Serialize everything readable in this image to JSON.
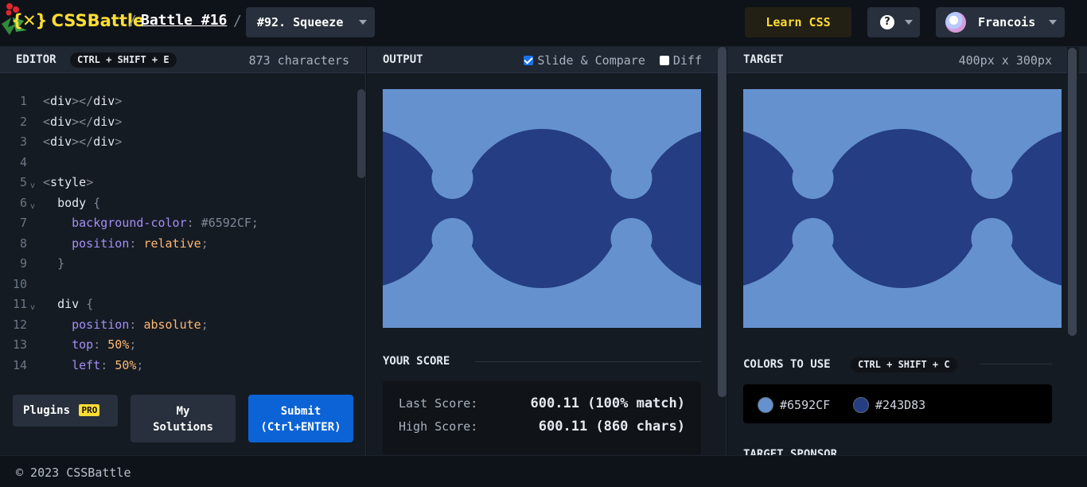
{
  "header": {
    "logo": "CSSBattle",
    "logo_mark": "{✕}",
    "separator": "/",
    "battle": "Battle #16",
    "target_select": "#92. Squeeze",
    "learn": "Learn CSS",
    "help": "?",
    "user": "Francois"
  },
  "editor": {
    "title": "EDITOR",
    "shortcut": "CTRL + SHIFT + E",
    "char_count": "873 characters",
    "lines": [
      {
        "n": "1",
        "fold": false,
        "html": "<span class='t-punc'>&lt;</span><span class='t-tag'>div</span><span class='t-punc'>&gt;&lt;/</span><span class='t-tag'>div</span><span class='t-punc'>&gt;</span>"
      },
      {
        "n": "2",
        "fold": false,
        "html": "<span class='t-punc'>&lt;</span><span class='t-tag'>div</span><span class='t-punc'>&gt;&lt;/</span><span class='t-tag'>div</span><span class='t-punc'>&gt;</span>"
      },
      {
        "n": "3",
        "fold": false,
        "html": "<span class='t-punc'>&lt;</span><span class='t-tag'>div</span><span class='t-punc'>&gt;&lt;/</span><span class='t-tag'>div</span><span class='t-punc'>&gt;</span>"
      },
      {
        "n": "4",
        "fold": false,
        "html": ""
      },
      {
        "n": "5",
        "fold": true,
        "html": "<span class='t-punc'>&lt;</span><span class='t-tag'>style</span><span class='t-punc'>&gt;</span>"
      },
      {
        "n": "6",
        "fold": true,
        "html": "  <span class='t-tag'>body</span> <span class='t-punc'>{</span>"
      },
      {
        "n": "7",
        "fold": false,
        "html": "    <span class='t-prop'>background-color</span><span class='t-punc'>:</span> <span class='t-hex'>#6592CF</span><span class='t-punc'>;</span>"
      },
      {
        "n": "8",
        "fold": false,
        "html": "    <span class='t-prop'>position</span><span class='t-punc'>:</span> <span class='t-val'>relative</span><span class='t-punc'>;</span>"
      },
      {
        "n": "9",
        "fold": false,
        "html": "  <span class='t-punc'>}</span>"
      },
      {
        "n": "10",
        "fold": false,
        "html": ""
      },
      {
        "n": "11",
        "fold": true,
        "html": "  <span class='t-tag'>div</span> <span class='t-punc'>{</span>"
      },
      {
        "n": "12",
        "fold": false,
        "html": "    <span class='t-prop'>position</span><span class='t-punc'>:</span> <span class='t-val'>absolute</span><span class='t-punc'>;</span>"
      },
      {
        "n": "13",
        "fold": false,
        "html": "    <span class='t-prop'>top</span><span class='t-punc'>:</span> <span class='t-num'>50%</span><span class='t-punc'>;</span>"
      },
      {
        "n": "14",
        "fold": false,
        "html": "    <span class='t-prop'>left</span><span class='t-punc'>:</span> <span class='t-num'>50%</span><span class='t-punc'>;</span>"
      }
    ],
    "plugins": "Plugins",
    "pro": "PRO",
    "my_solutions_1": "My",
    "my_solutions_2": "Solutions",
    "submit_1": "Submit",
    "submit_2": "(Ctrl+ENTER)"
  },
  "output": {
    "title": "OUTPUT",
    "slide_compare": "Slide & Compare",
    "diff": "Diff",
    "slide_checked": true,
    "diff_checked": false,
    "score_title": "YOUR SCORE",
    "last_label": "Last Score:",
    "last_value": "600.11 (100% match)",
    "high_label": "High Score:",
    "high_value": "600.11 (860 chars)"
  },
  "target": {
    "title": "TARGET",
    "size": "400px x 300px",
    "colors_title": "COLORS TO USE",
    "colors_shortcut": "CTRL + SHIFT + C",
    "colors": [
      {
        "hex": "#6592CF",
        "label": "#6592CF"
      },
      {
        "hex": "#243D83",
        "label": "#243D83"
      }
    ],
    "sponsor_title": "TARGET SPONSOR"
  },
  "footer": {
    "copyright": "© 2023 CSSBattle"
  },
  "theme": {
    "accent": "#ffdd33",
    "submit": "#0b63d6",
    "bg_light": "#6592CF",
    "bg_dark": "#243D83"
  }
}
